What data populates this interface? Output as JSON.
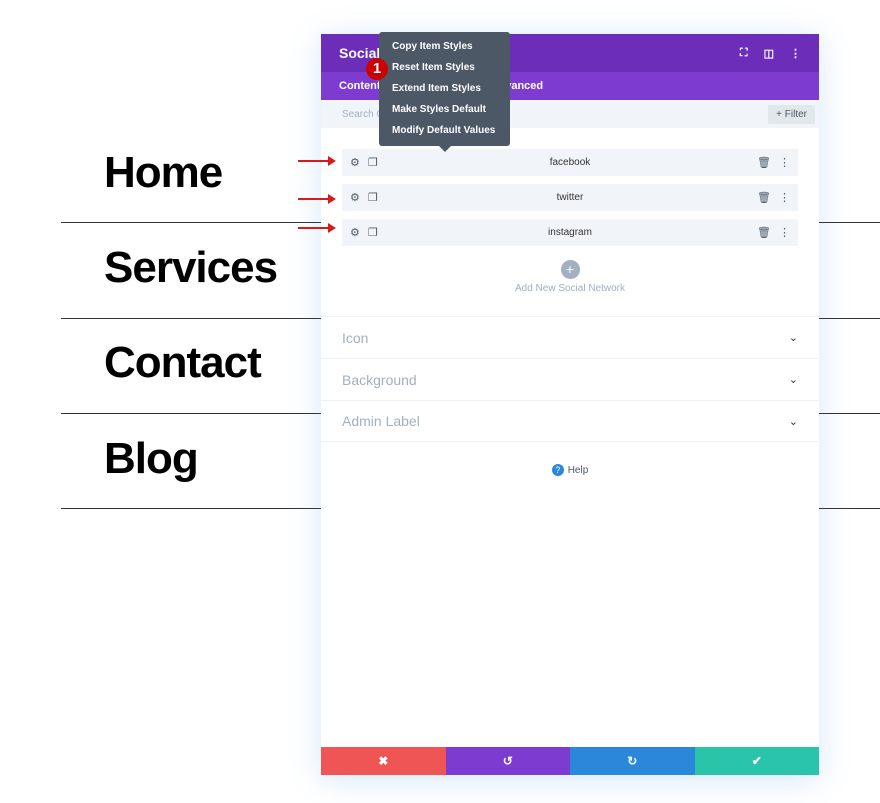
{
  "page_nav": [
    "Home",
    "Services",
    "Contact",
    "Blog"
  ],
  "panel": {
    "title": "Social",
    "tabs": [
      "Content",
      "Advanced"
    ],
    "search_placeholder": "Search Options",
    "filter_label": "+ Filter",
    "items": [
      "facebook",
      "twitter",
      "instagram"
    ],
    "add_label": "Add New Social Network",
    "toggles": [
      "Icon",
      "Background",
      "Admin Label"
    ],
    "help_label": "Help"
  },
  "context_menu": [
    "Copy Item Styles",
    "Reset Item Styles",
    "Extend Item Styles",
    "Make Styles Default",
    "Modify Default Values"
  ],
  "step_badge": "1",
  "colors": {
    "header": "#6c2eb9",
    "tabs": "#7e3bd0",
    "cancel": "#ef5555",
    "undo": "#7e3bd0",
    "redo": "#2b87da",
    "save": "#29c4a9",
    "arrow": "#d91a1a"
  }
}
